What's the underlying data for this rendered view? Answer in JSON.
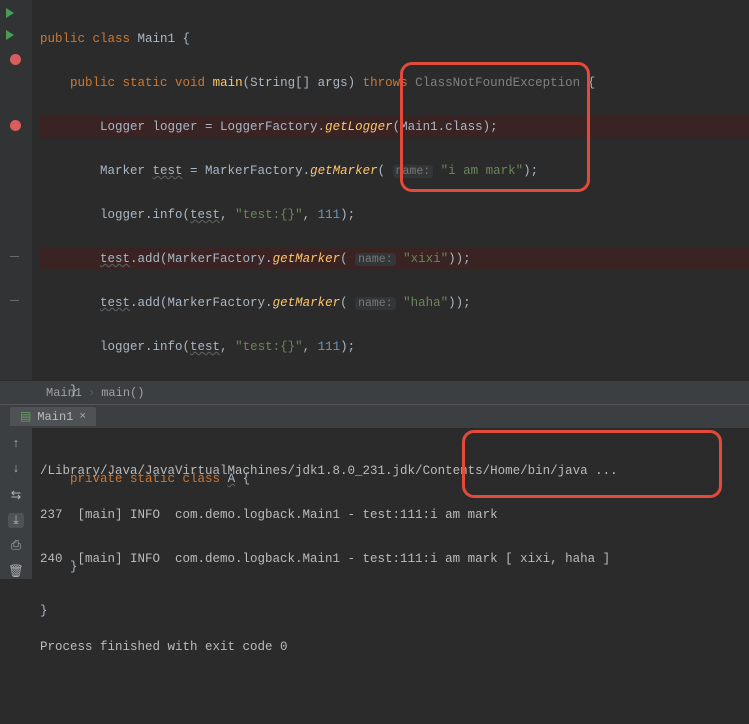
{
  "breadcrumb": {
    "cls": "Main1",
    "method": "main()"
  },
  "tabs": {
    "run_tab": "Main1"
  },
  "code": {
    "l1": {
      "kw1": "public class",
      "cls": "Main1",
      "brace": " {"
    },
    "l2": {
      "kw1": "public static void",
      "m": "main",
      "args": "(String[] args)",
      "kw2": "throws",
      "ex": "ClassNotFoundException",
      "end": " {"
    },
    "l3": {
      "t": "Logger logger = LoggerFactory.",
      "m": "getLogger",
      "arg": "(Main1.class);"
    },
    "l4": {
      "a": "Marker ",
      "var": "test",
      "b": " = MarkerFactory.",
      "m": "getMarker",
      "hp": "name:",
      "s": "\"i am mark\"",
      "end": ");"
    },
    "l5": {
      "a": "logger.info(",
      "var": "test",
      "c": ", ",
      "s": "\"test:{}\"",
      "c2": ", ",
      "n": "111",
      "end": ");"
    },
    "l6": {
      "var": "test",
      "a": ".add(MarkerFactory.",
      "m": "getMarker",
      "hp": "name:",
      "s": "\"xixi\"",
      "end": "));"
    },
    "l7": {
      "var": "test",
      "a": ".add(MarkerFactory.",
      "m": "getMarker",
      "hp": "name:",
      "s": "\"haha\"",
      "end": "));"
    },
    "l8": {
      "a": "logger.info(",
      "var": "test",
      "c": ", ",
      "s": "\"test:{}\"",
      "c2": ", ",
      "n": "111",
      "end": ");"
    },
    "l9": "    }",
    "l11": {
      "kw": "private static class",
      "cls": "A",
      "end": " {"
    },
    "l13": "    }",
    "l14": "}"
  },
  "console": {
    "l1a": "/Library/Java/JavaVirtualMachines/jdk1.8.0_231.jdk/",
    "l1b": "Contents/Home/bin/java",
    "l1c": " ...",
    "l2a": "237  [main] INFO  com.demo.logback.Main1 - test:111:",
    "l2b": "i am mark",
    "l3a": "240  [main] INFO  com.demo.logback.Main1 - test:111:",
    "l3b": "i am mark [ xixi, haha ]",
    "l5": "Process finished with exit code 0"
  }
}
